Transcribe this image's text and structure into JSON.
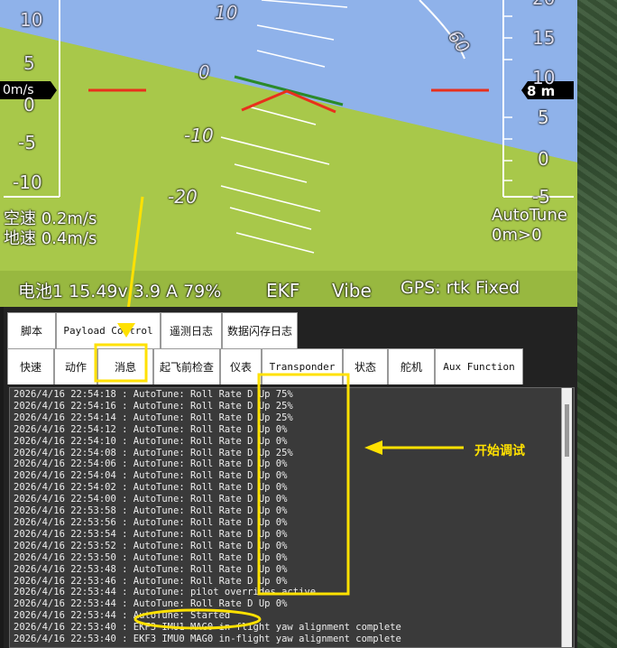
{
  "hud": {
    "pitch_labels": [
      "10",
      "0",
      "-10",
      "-20"
    ],
    "roll_label": "60",
    "left_scale": [
      "10",
      "5",
      "0",
      "-5",
      "-10"
    ],
    "right_scale": [
      "20",
      "15",
      "10",
      "5",
      "0",
      "-5"
    ],
    "left_readout": "0m/s",
    "right_readout": "8 m",
    "airspeed": "空速 0.2m/s",
    "groundspeed": "地速 0.4m/s",
    "mode": "AutoTune",
    "mode_sub": "0m>0",
    "battery": "电池1 15.49v 3.9 A 79%",
    "ekf": "EKF",
    "vibe": "Vibe",
    "gps": "GPS: rtk Fixed",
    "colors": {
      "sky": "#8fb2ea",
      "ground": "#a8c84a",
      "attitude": "#e8301c",
      "horizon": "#2a8a2a"
    }
  },
  "tabs_row1": [
    "脚本",
    "Payload Control",
    "遥测日志",
    "数据闪存日志"
  ],
  "tabs_row2": [
    "快速",
    "动作",
    "消息",
    "起飞前检查",
    "仪表",
    "Transponder",
    "状态",
    "舵机",
    "Aux Function"
  ],
  "log_lines": [
    "2026/4/16 22:54:18 : AutoTune: Roll Rate D Up 75%",
    "2026/4/16 22:54:16 : AutoTune: Roll Rate D Up 25%",
    "2026/4/16 22:54:14 : AutoTune: Roll Rate D Up 25%",
    "2026/4/16 22:54:12 : AutoTune: Roll Rate D Up 0%",
    "2026/4/16 22:54:10 : AutoTune: Roll Rate D Up 0%",
    "2026/4/16 22:54:08 : AutoTune: Roll Rate D Up 25%",
    "2026/4/16 22:54:06 : AutoTune: Roll Rate D Up 0%",
    "2026/4/16 22:54:04 : AutoTune: Roll Rate D Up 0%",
    "2026/4/16 22:54:02 : AutoTune: Roll Rate D Up 0%",
    "2026/4/16 22:54:00 : AutoTune: Roll Rate D Up 0%",
    "2026/4/16 22:53:58 : AutoTune: Roll Rate D Up 0%",
    "2026/4/16 22:53:56 : AutoTune: Roll Rate D Up 0%",
    "2026/4/16 22:53:54 : AutoTune: Roll Rate D Up 0%",
    "2026/4/16 22:53:52 : AutoTune: Roll Rate D Up 0%",
    "2026/4/16 22:53:50 : AutoTune: Roll Rate D Up 0%",
    "2026/4/16 22:53:48 : AutoTune: Roll Rate D Up 0%",
    "2026/4/16 22:53:46 : AutoTune: Roll Rate D Up 0%",
    "2026/4/16 22:53:44 : AutoTune: pilot overrides active",
    "2026/4/16 22:53:44 : AutoTune: Roll Rate D Up 0%",
    "2026/4/16 22:53:44 : AutoTune: Started",
    "2026/4/16 22:53:40 : EKF3 IMU1 MAG0 in-flight yaw alignment complete",
    "2026/4/16 22:53:40 : EKF3 IMU0 MAG0 in-flight yaw alignment complete"
  ],
  "annotation": {
    "label": "开始调试",
    "color": "#ffe100"
  }
}
